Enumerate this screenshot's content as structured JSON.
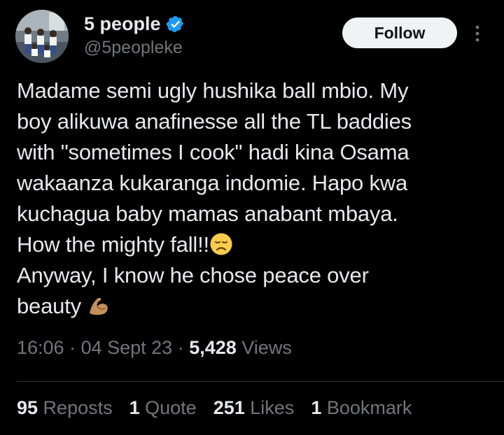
{
  "author": {
    "display_name": "5 people",
    "handle": "@5peopleke",
    "verified": true,
    "avatar_icon": "group-photo-avatar",
    "verified_color": "#1d9bf0"
  },
  "follow_button": {
    "label": "Follow"
  },
  "tweet": {
    "lines": [
      "Madame semi ugly hushika ball mbio. My",
      "boy alikuwa anafinesse all the TL baddies",
      "with \"sometimes I cook\" hadi kina Osama",
      "wakaanza kukaranga indomie. Hapo kwa",
      "kuchagua baby mamas anabant mbaya.",
      "How the mighty fall!!",
      "Anyway, I know he chose peace over",
      "beauty"
    ],
    "emoji_1": "disappointed-face-emoji",
    "emoji_2": "flexed-biceps-emoji"
  },
  "meta": {
    "time": "16:06",
    "separator": " · ",
    "date": "04 Sept 23",
    "views_count": "5,428",
    "views_label": " Views"
  },
  "stats": {
    "reposts": {
      "count": "95",
      "label": " Reposts"
    },
    "quotes": {
      "count": "1",
      "label": " Quote"
    },
    "likes": {
      "count": "251",
      "label": " Likes"
    },
    "bookmarks": {
      "count": "1",
      "label": " Bookmark"
    }
  },
  "colors": {
    "background": "#000000",
    "text": "#e7e9ea",
    "muted": "#71767b",
    "button_bg": "#eff3f4"
  }
}
